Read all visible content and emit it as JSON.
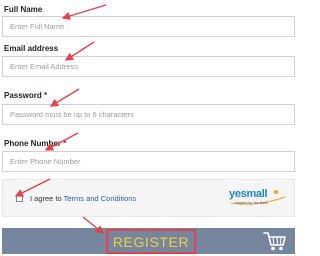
{
  "form": {
    "full_name": {
      "label": "Full Name",
      "required": false,
      "placeholder": "Enter Full Name",
      "value": ""
    },
    "email": {
      "label": "Email address",
      "required": false,
      "placeholder": "Enter Email Address",
      "value": ""
    },
    "password": {
      "label": "Password",
      "required_mark": "*",
      "placeholder": "Password must be up to 6 characters",
      "value": ""
    },
    "phone": {
      "label": "Phone Number",
      "required_mark": "*",
      "placeholder": "Enter Phone Number",
      "value": ""
    }
  },
  "terms": {
    "prefix": "I agree to ",
    "link_text": "Terms and Conditions",
    "checked": false
  },
  "logo": {
    "text": "yesmall",
    "tagline": "Inspired by Yes Bank"
  },
  "register": {
    "label": "REGISTER"
  },
  "icons": {
    "cart": "shopping-cart-icon"
  },
  "colors": {
    "annotation_red": "#e0434b",
    "register_bar": "#76869f",
    "register_text": "#f1cd3d",
    "link_blue": "#2a5db0",
    "logo_blue": "#1e88c7"
  }
}
